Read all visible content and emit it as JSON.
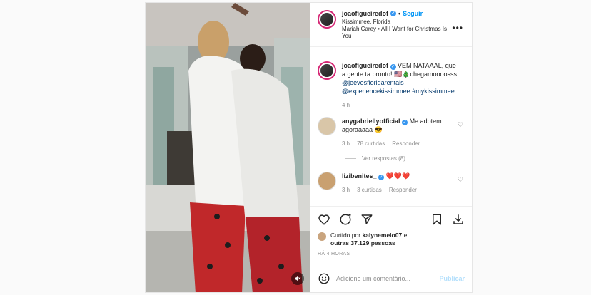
{
  "post": {
    "username": "joaofigueiredof",
    "follow_label": "Seguir",
    "location": "Kissimmee, Florida",
    "audio": "Mariah Carey • All I Want for Christmas Is You",
    "more_icon": "more-icon"
  },
  "caption": {
    "username": "joaofigueiredof",
    "text_part1": "VEM NATAAAL, que a gente ta pronto! 🇺🇸🎄chegamoooosss",
    "mention1": "@jeevesfloridarentals",
    "mention2": "@experiencekissimmee",
    "hashtag": "#mykissimmee",
    "time": "4 h"
  },
  "comments": [
    {
      "username": "anygabriellyofficial",
      "text": "Me adotem agoraaaaa 😎",
      "time": "3 h",
      "likes": "78 curtidas",
      "reply": "Responder",
      "view_replies": "Ver respostas (8)"
    },
    {
      "username": "lizibenites_",
      "text": "❤️❤️❤️",
      "time": "3 h",
      "likes": "3 curtidas",
      "reply": "Responder"
    }
  ],
  "likes": {
    "prefix": "Curtido por",
    "user": "kalynemelo07",
    "middle": "e",
    "others": "outras 37.129 pessoas"
  },
  "posted_ago": "HÁ 4 HORAS",
  "comment_box": {
    "placeholder": "Adicione um comentário...",
    "publish": "Publicar"
  },
  "colors": {
    "accent": "#0095f6",
    "verified": "#3897f0",
    "publish_disabled": "#b2dffc"
  }
}
